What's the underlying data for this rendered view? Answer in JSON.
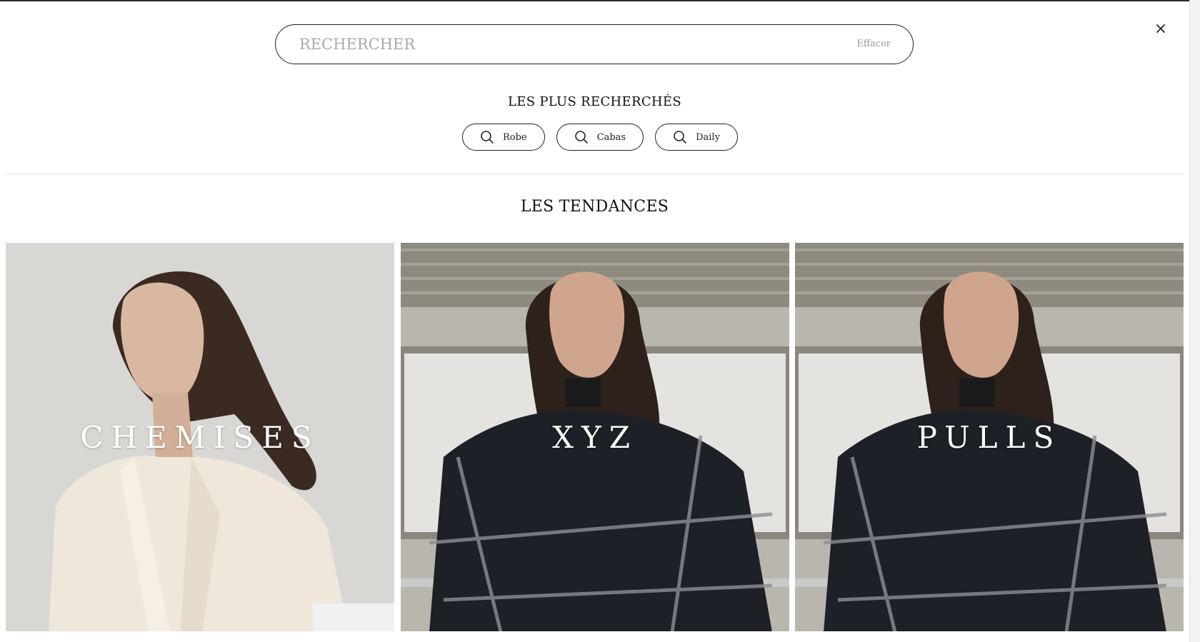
{
  "search": {
    "placeholder": "RECHERCHER",
    "value": "",
    "clear_label": "Effacer"
  },
  "close": {
    "icon": "close-icon",
    "glyph": "✕"
  },
  "popular": {
    "title": "LES PLUS RECHERCHÉS",
    "items": [
      {
        "label": "Robe",
        "icon": "search-icon"
      },
      {
        "label": "Cabas",
        "icon": "search-icon"
      },
      {
        "label": "Daily",
        "icon": "search-icon"
      }
    ]
  },
  "trends": {
    "title": "LES TENDANCES",
    "tiles": [
      {
        "label": "CHEMISES",
        "image": "woman-in-cream-blouse-photo"
      },
      {
        "label": "XYZ",
        "image": "woman-in-plaid-coat-photo"
      },
      {
        "label": "PULLS",
        "image": "woman-in-plaid-coat-photo"
      }
    ]
  },
  "colors": {
    "border": "#222222",
    "placeholder": "#a9a9a9",
    "divider": "#e6e6e6",
    "label": "#ffffff"
  }
}
